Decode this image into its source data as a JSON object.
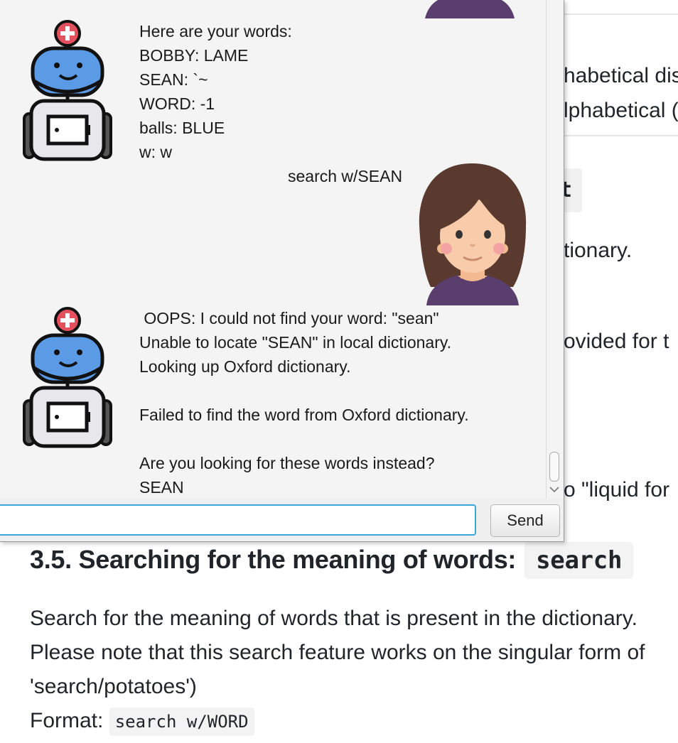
{
  "doc": {
    "frag_alphabetical_1": "habetical dis",
    "frag_alphabetical_2": "lphabetical (",
    "frag_code": "t",
    "frag_dictionary": "tionary.",
    "frag_provided": "ovided for t",
    "frag_liquid": "o \"liquid for",
    "heading": "3.5. Searching for the meaning of words:",
    "heading_code": "search",
    "para_1": "Search for the meaning of words that is present in the dictionary.",
    "para_2": "Please note that this search feature works on the singular form of",
    "para_3": "'search/potatoes')",
    "format_label": "Format:",
    "format_code": "search w/WORD"
  },
  "chat": {
    "messages": [
      {
        "sender": "bot",
        "text": "Here are your words:\nBOBBY: LAME\nSEAN: `~\nWORD: -1\nballs: BLUE\nw: w"
      },
      {
        "sender": "user",
        "text": "search w/SEAN"
      },
      {
        "sender": "bot",
        "text": " OOPS: I could not find your word: \"sean\"\nUnable to locate \"SEAN\" in local dictionary.\nLooking up Oxford dictionary.\n\nFailed to find the word from Oxford dictionary.\n\nAre you looking for these words instead?\nSEAN"
      }
    ],
    "input_value": "",
    "send_label": "Send"
  },
  "colors": {
    "window_bg": "#f4f4f4",
    "input_focus": "#3aa5d8",
    "robot_blue": "#5b9be6",
    "robot_red": "#e4505e",
    "hair": "#5a3a2e",
    "shirt": "#5a3f6e"
  },
  "icons": {
    "bot_avatar": "robot-icon",
    "user_avatar": "girl-avatar-icon",
    "scroll_down": "chevron-down-icon"
  }
}
